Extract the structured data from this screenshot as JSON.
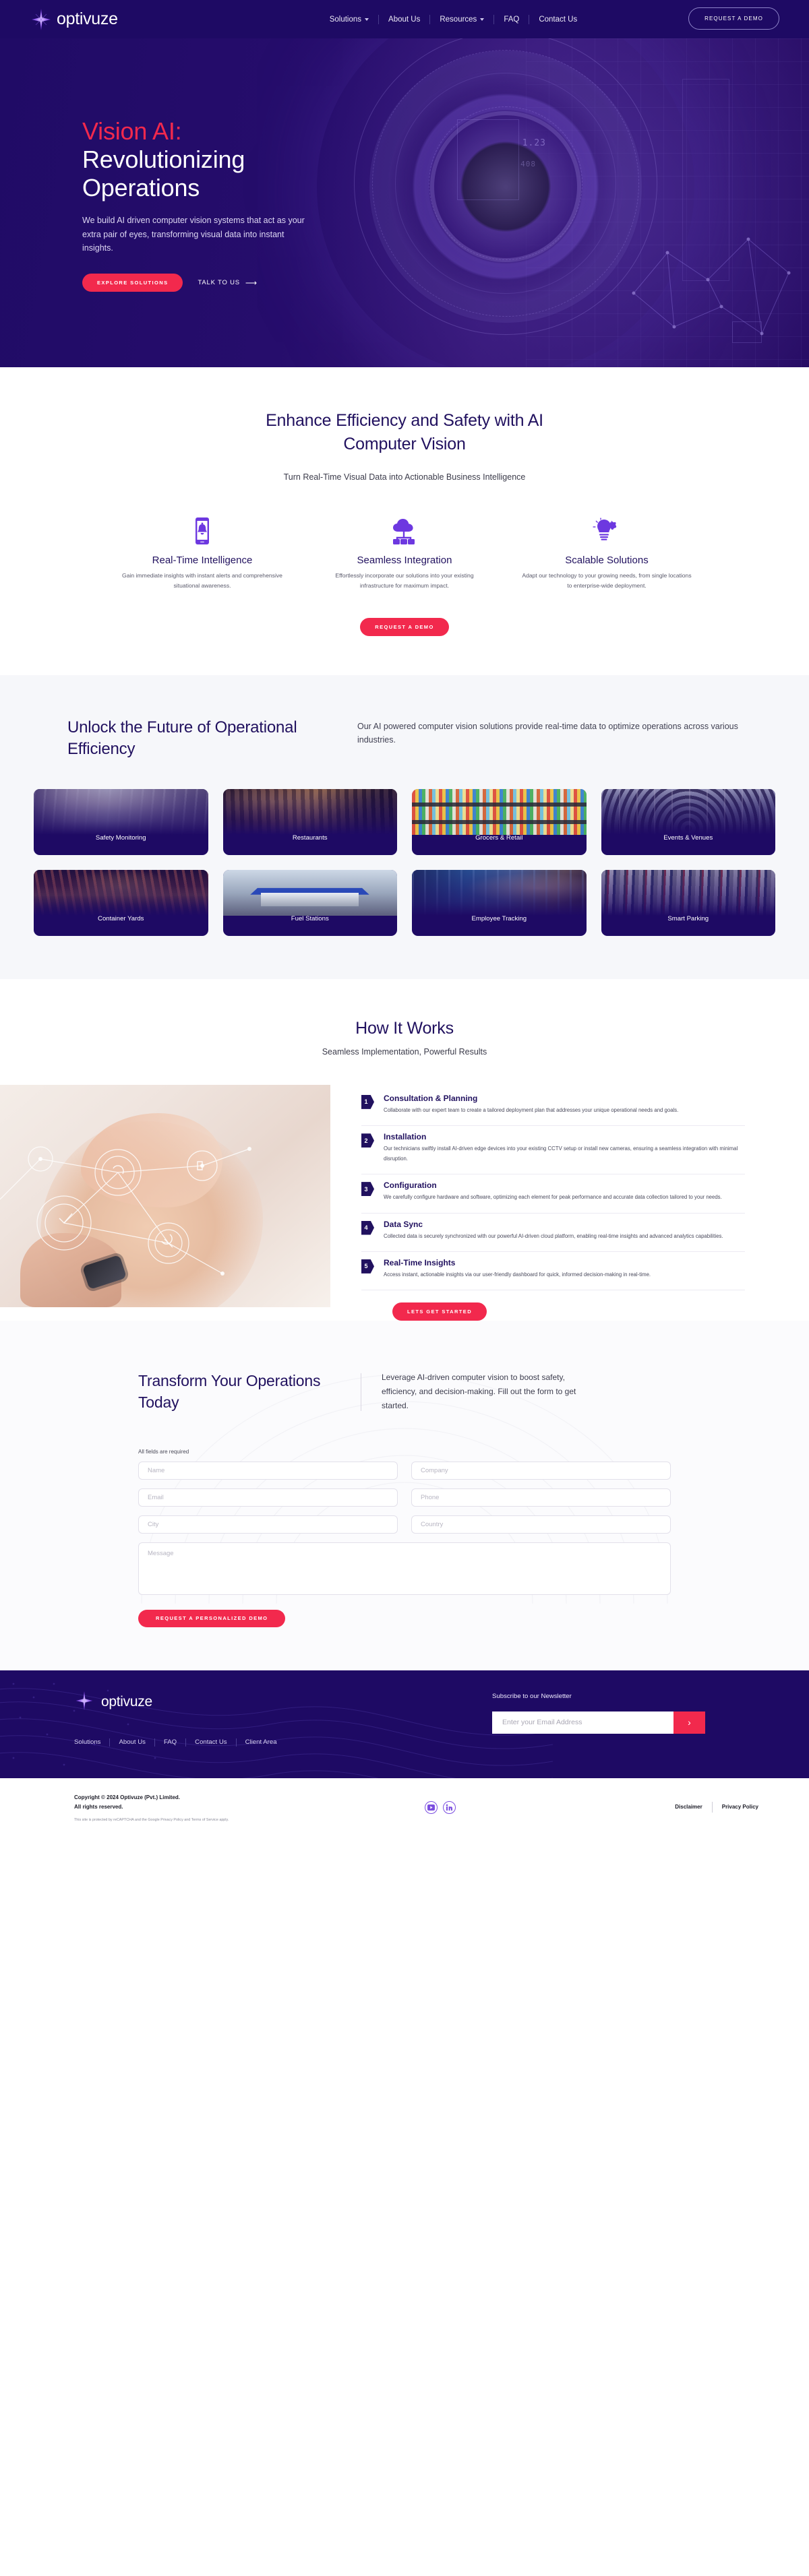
{
  "brand": {
    "name": "optivuze",
    "accent_pink": "#f2294d",
    "accent_purple": "#7b4ee0",
    "deep_navy": "#1e0a64"
  },
  "header": {
    "nav": [
      {
        "label": "Solutions",
        "has_caret": true
      },
      {
        "label": "About Us",
        "has_caret": false
      },
      {
        "label": "Resources",
        "has_caret": true
      },
      {
        "label": "FAQ",
        "has_caret": false
      },
      {
        "label": "Contact Us",
        "has_caret": false
      }
    ],
    "cta": "REQUEST A DEMO"
  },
  "hero": {
    "title_line1": "Vision AI:",
    "title_line2": "Revolutionizing",
    "title_line3": "Operations",
    "subtitle": "We build AI driven computer vision systems that act as your extra pair of eyes, transforming visual data into instant insights.",
    "primary_cta": "EXPLORE SOLUTIONS",
    "secondary_cta": "TALK TO US",
    "hud_value_1": "1.23",
    "hud_value_2": "408"
  },
  "efficiency": {
    "heading": "Enhance Efficiency and Safety with AI Computer Vision",
    "subheading": "Turn Real-Time Visual Data into Actionable Business Intelligence",
    "features": [
      {
        "icon": "mobile-alert-icon",
        "title": "Real-Time Intelligence",
        "desc": "Gain immediate insights with instant alerts and comprehensive situational awareness."
      },
      {
        "icon": "cloud-network-icon",
        "title": "Seamless Integration",
        "desc": "Effortlessly incorporate our solutions into your existing infrastructure for maximum impact."
      },
      {
        "icon": "lightbulb-puzzle-icon",
        "title": "Scalable Solutions",
        "desc": "Adapt our technology to your growing needs, from single locations to enterprise-wide deployment."
      }
    ],
    "cta": "REQUEST A DEMO"
  },
  "industries": {
    "heading": "Unlock the Future of Operational Efficiency",
    "description": "Our AI powered computer vision solutions provide real-time data to optimize operations across various industries.",
    "cards": [
      {
        "label": "Safety Monitoring",
        "art": "art-safety"
      },
      {
        "label": "Restaurants",
        "art": "art-rest"
      },
      {
        "label": "Grocers & Retail",
        "art": "art-groc"
      },
      {
        "label": "Events & Venues",
        "art": "art-events"
      },
      {
        "label": "Container Yards",
        "art": "art-cont"
      },
      {
        "label": "Fuel Stations",
        "art": "art-fuel"
      },
      {
        "label": "Employee Tracking",
        "art": "art-emp"
      },
      {
        "label": "Smart Parking",
        "art": "art-park"
      }
    ]
  },
  "how_it_works": {
    "heading": "How It Works",
    "subheading": "Seamless Implementation, Powerful Results",
    "steps": [
      {
        "num": "1",
        "title": "Consultation & Planning",
        "desc": "Collaborate with our expert team to create a tailored deployment plan that addresses your unique operational needs and goals."
      },
      {
        "num": "2",
        "title": "Installation",
        "desc": "Our technicians swiftly install AI-driven edge devices into your existing CCTV setup or install new cameras, ensuring a seamless integration with minimal disruption."
      },
      {
        "num": "3",
        "title": "Configuration",
        "desc": "We carefully configure hardware and software, optimizing each element for peak performance and accurate data collection tailored to your needs."
      },
      {
        "num": "4",
        "title": "Data Sync",
        "desc": "Collected data is securely synchronized with our powerful AI-driven cloud platform, enabling real-time insights and advanced analytics capabilities."
      },
      {
        "num": "5",
        "title": "Real-Time Insights",
        "desc": "Access instant, actionable insights via our user-friendly dashboard for quick, informed decision-making in real-time."
      }
    ],
    "cta": "LETS GET STARTED"
  },
  "contact": {
    "heading": "Transform Your Operations Today",
    "description": "Leverage AI-driven computer vision to boost safety, efficiency, and decision-making. Fill out the form to get started.",
    "required_note": "All fields are required",
    "fields": [
      {
        "name": "name",
        "placeholder": "Name",
        "value": ""
      },
      {
        "name": "company",
        "placeholder": "Company",
        "value": ""
      },
      {
        "name": "email",
        "placeholder": "Email",
        "value": ""
      },
      {
        "name": "phone",
        "placeholder": "Phone",
        "value": ""
      },
      {
        "name": "city",
        "placeholder": "City",
        "value": ""
      },
      {
        "name": "country",
        "placeholder": "Country",
        "value": ""
      }
    ],
    "message_placeholder": "Message",
    "message_value": "",
    "submit": "REQUEST A PERSONALIZED DEMO"
  },
  "footer": {
    "logo": "optivuze",
    "links": [
      "Solutions",
      "About Us",
      "FAQ",
      "Contact Us",
      "Client Area"
    ],
    "newsletter_label": "Subscribe to our Newsletter",
    "newsletter_placeholder": "Enter your Email Address",
    "newsletter_value": "",
    "newsletter_button_icon": "chevron-right-icon",
    "copyright_line1": "Copyright © 2024 Optivuze (Pvt.) Limited.",
    "copyright_line2": "All rights reserved.",
    "recaptcha_note": "This site is protected by reCAPTCHA and the Google Privacy Policy and Terms of Service apply.",
    "social": [
      "youtube-icon",
      "linkedin-icon"
    ],
    "legal": [
      "Disclaimer",
      "Privacy Policy"
    ]
  }
}
